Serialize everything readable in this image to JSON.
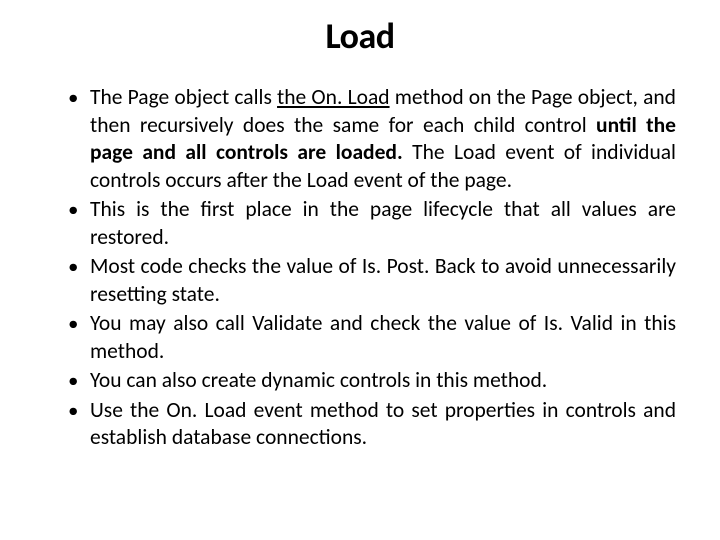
{
  "title": "Load",
  "bullets": [
    {
      "pre": "The Page object calls ",
      "u1": "the On. Load",
      "mid": " method on the Page object, and then recursively does the same for each child control ",
      "bold": "until the page and all controls are loaded.",
      "post": " The Load event of individual controls occurs after the Load event of the page."
    },
    {
      "text": "This is the first place in the page lifecycle that all values are restored."
    },
    {
      "text": "Most code checks the value of Is. Post. Back to avoid unnecessarily resetting state."
    },
    {
      "text": "You may also call Validate and check the value of Is. Valid in this method."
    },
    {
      "text": "You can also create dynamic controls in this method."
    },
    {
      "text": "Use the On. Load event method to set properties in controls and establish database connections."
    }
  ]
}
